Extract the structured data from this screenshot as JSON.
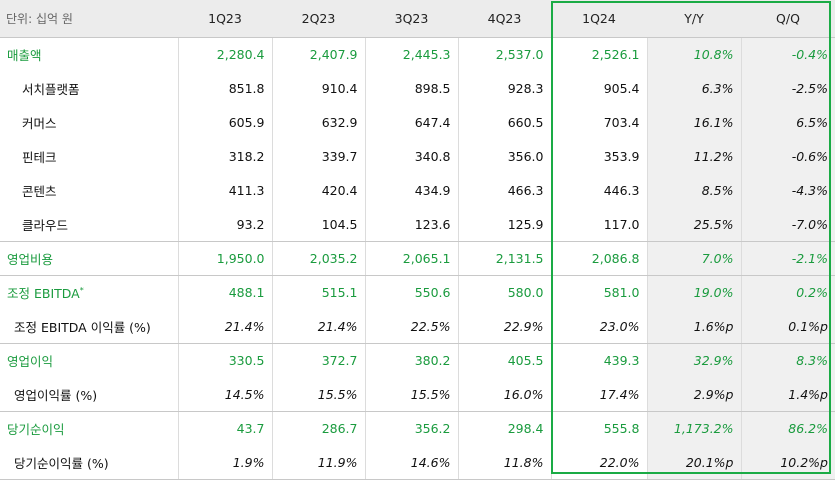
{
  "unit_label": "단위: 십억 원",
  "columns": [
    "1Q23",
    "2Q23",
    "3Q23",
    "4Q23",
    "1Q24",
    "Y/Y",
    "Q/Q"
  ],
  "rows": [
    {
      "label": "매출액",
      "type": "main",
      "values": [
        "2,280.4",
        "2,407.9",
        "2,445.3",
        "2,537.0",
        "2,526.1",
        "10.8%",
        "-0.4%"
      ]
    },
    {
      "label": "서치플랫폼",
      "type": "sub",
      "values": [
        "851.8",
        "910.4",
        "898.5",
        "928.3",
        "905.4",
        "6.3%",
        "-2.5%"
      ]
    },
    {
      "label": "커머스",
      "type": "sub",
      "values": [
        "605.9",
        "632.9",
        "647.4",
        "660.5",
        "703.4",
        "16.1%",
        "6.5%"
      ]
    },
    {
      "label": "핀테크",
      "type": "sub",
      "values": [
        "318.2",
        "339.7",
        "340.8",
        "356.0",
        "353.9",
        "11.2%",
        "-0.6%"
      ]
    },
    {
      "label": "콘텐츠",
      "type": "sub",
      "values": [
        "411.3",
        "420.4",
        "434.9",
        "466.3",
        "446.3",
        "8.5%",
        "-4.3%"
      ]
    },
    {
      "label": "클라우드",
      "type": "sub",
      "values": [
        "93.2",
        "104.5",
        "123.6",
        "125.9",
        "117.0",
        "25.5%",
        "-7.0%"
      ]
    },
    {
      "label": "영업비용",
      "type": "main",
      "values": [
        "1,950.0",
        "2,035.2",
        "2,065.1",
        "2,131.5",
        "2,086.8",
        "7.0%",
        "-2.1%"
      ]
    },
    {
      "label": "조정 EBITDA",
      "sup": "*",
      "type": "main",
      "values": [
        "488.1",
        "515.1",
        "550.6",
        "580.0",
        "581.0",
        "19.0%",
        "0.2%"
      ]
    },
    {
      "label": "조정 EBITDA 이익률 (%)",
      "type": "sub3",
      "values": [
        "21.4%",
        "21.4%",
        "22.5%",
        "22.9%",
        "23.0%",
        "1.6%p",
        "0.1%p"
      ]
    },
    {
      "label": "영업이익",
      "type": "main",
      "values": [
        "330.5",
        "372.7",
        "380.2",
        "405.5",
        "439.3",
        "32.9%",
        "8.3%"
      ]
    },
    {
      "label": "영업이익률 (%)",
      "type": "sub3",
      "values": [
        "14.5%",
        "15.5%",
        "15.5%",
        "16.0%",
        "17.4%",
        "2.9%p",
        "1.4%p"
      ]
    },
    {
      "label": "당기순이익",
      "type": "main",
      "values": [
        "43.7",
        "286.7",
        "356.2",
        "298.4",
        "555.8",
        "1,173.2%",
        "86.2%"
      ]
    },
    {
      "label": "당기순이익률 (%)",
      "type": "sub3",
      "values": [
        "1.9%",
        "11.9%",
        "14.6%",
        "11.8%",
        "22.0%",
        "20.1%p",
        "10.2%p"
      ]
    }
  ],
  "colors": {
    "accent_green": "#1a9b3e",
    "highlight_border": "#1aab45",
    "header_bg": "#ececec",
    "shade_bg": "#f0f0f0"
  }
}
